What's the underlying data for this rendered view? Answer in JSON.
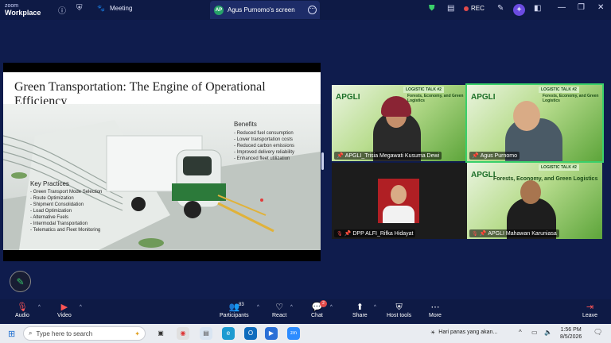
{
  "app": {
    "logo_line1": "zoom",
    "logo_line2": "Workplace"
  },
  "titlebar": {
    "meeting_label": "Meeting",
    "screen_share_tab": "Agus Purnomo's screen",
    "screen_badge": "AP",
    "rec_label": "REC"
  },
  "slide": {
    "title": "Green Transportation: The Engine of Operational Efficiency",
    "benefits_title": "Benefits",
    "benefits": [
      "- Reduced fuel consumption",
      "- Lower transportation costs",
      "- Reduced carbon emissions",
      "- Improved delivery reliability",
      "- Enhanced fleet utilization"
    ],
    "practices_title": "Key Practices",
    "practices": [
      "- Green Transport Mode Selection",
      "- Route Optimization",
      "- Shipment Consolidation",
      "- Load Optimization",
      "- Alternative Fuels",
      "- Intermodal Transportation",
      "- Telematics and Fleet Monitoring"
    ]
  },
  "tiles": [
    {
      "name": "APGLI_Trisia Megawati Kusuma Dewi",
      "banner": "LOGISTIC TALK #2",
      "logo": "APGLI",
      "headline": "Forests, Economy, and Green Logistics"
    },
    {
      "name": "Agus Purnomo",
      "banner": "LOGISTIC TALK #2",
      "logo": "APGLI",
      "headline": "Forests, Economy, and Green Logistics"
    },
    {
      "name": "DPP ALFI_Rifka Hidayat"
    },
    {
      "name": "APGLI Mahawan Karuniasa",
      "banner": "LOGISTIC TALK #2",
      "logo": "APGLI",
      "headline": "Forests, Economy, and Green Logistics"
    }
  ],
  "controls": {
    "audio": "Audio",
    "video": "Video",
    "participants": "Participants",
    "participants_count": "83",
    "react": "React",
    "chat": "Chat",
    "chat_badge": "2",
    "share": "Share",
    "host_tools": "Host tools",
    "more": "More",
    "leave": "Leave"
  },
  "taskbar": {
    "search_placeholder": "Type here to search",
    "weather_text": "Hari panas yang akan...",
    "time": "1:56 PM",
    "date": "8/5/2026"
  },
  "colors": {
    "accent_green": "#3ad06a",
    "rec_red": "#e24b4b",
    "bar_bg": "#0e1a45"
  }
}
